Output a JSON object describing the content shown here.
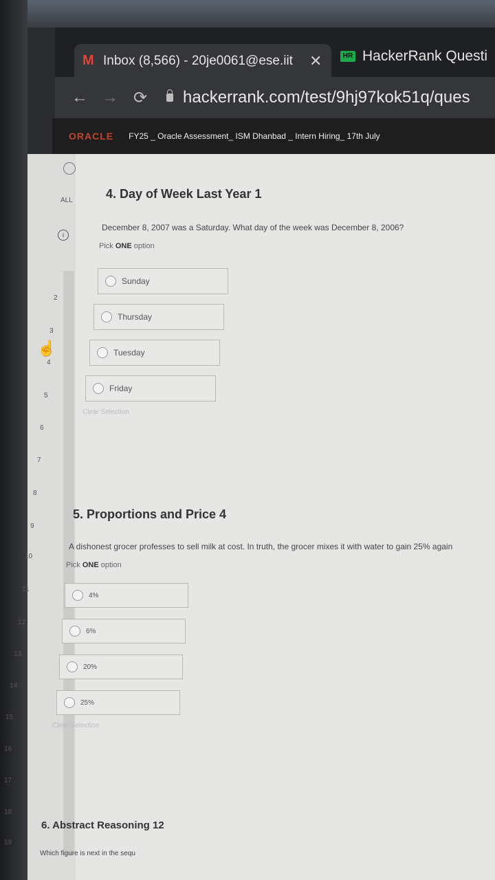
{
  "browser": {
    "tabs": [
      {
        "label": "Inbox (8,566) - 20je0061@ese.iit",
        "icon": "gmail-icon",
        "active": true
      },
      {
        "label": "HackerRank Questi",
        "icon": "hackerrank-icon",
        "active": false
      }
    ],
    "url": "hackerrank.com/test/9hj97kok51q/ques",
    "close_symbol": "✕"
  },
  "test": {
    "brand": "ORACLE",
    "title": "FY25 _ Oracle Assessment_ ISM Dhanbad _ Intern Hiring_ 17th July"
  },
  "sidebar": {
    "all_label": "ALL",
    "info_symbol": "i",
    "numbers": [
      "2",
      "3",
      "4",
      "5",
      "6",
      "7",
      "8",
      "9",
      "10",
      "11",
      "12",
      "13",
      "14",
      "15",
      "16",
      "17",
      "18",
      "19"
    ]
  },
  "questions": [
    {
      "title": "4. Day of Week Last Year 1",
      "text": "December 8, 2007 was a Saturday. What day of the week was December 8, 2006?",
      "hint_prefix": "Pick ",
      "hint_bold": "ONE",
      "hint_suffix": " option",
      "options": [
        "Sunday",
        "Thursday",
        "Tuesday",
        "Friday"
      ],
      "clear": "Clear Selection"
    },
    {
      "title": "5. Proportions and Price 4",
      "text": "A dishonest grocer professes to sell milk at cost. In truth, the grocer mixes it with water to gain 25% again",
      "hint_prefix": "Pick ",
      "hint_bold": "ONE",
      "hint_suffix": " option",
      "options": [
        "4%",
        "6%",
        "20%",
        "25%"
      ],
      "clear": "Clear Selection"
    },
    {
      "title": "6. Abstract Reasoning 12",
      "text": "Which figure is next in the sequ"
    }
  ]
}
